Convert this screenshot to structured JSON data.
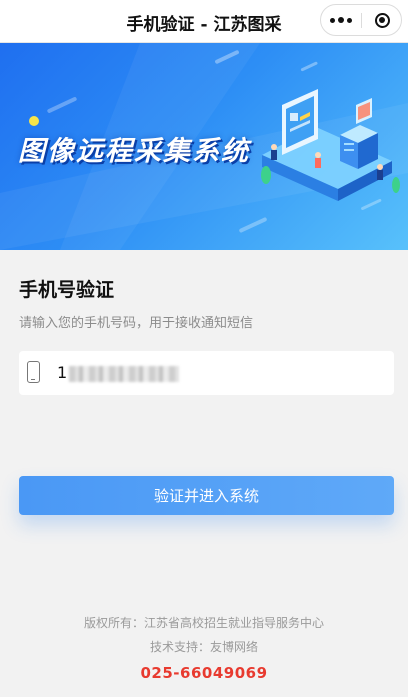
{
  "nav": {
    "title": "手机验证 - 江苏图采",
    "more_icon": "more-dots-icon",
    "close_icon": "target-close-icon"
  },
  "banner": {
    "title": "图像远程采集系统"
  },
  "form": {
    "title": "手机号验证",
    "hint": "请输入您的手机号码，用于接收通知短信",
    "phone_value": "1",
    "phone_icon": "mobile-phone-icon",
    "submit_label": "验证并进入系统"
  },
  "footer": {
    "copyright": "版权所有：江苏省高校招生就业指导服务中心",
    "tech_support": "技术支持：友博网络",
    "phone": "025-66049069"
  },
  "colors": {
    "banner_start": "#1f6ff0",
    "banner_end": "#58c1fb",
    "button": "#5aa5f7",
    "phone_red": "#e83a2f",
    "page_bg": "#f2f2f2"
  }
}
